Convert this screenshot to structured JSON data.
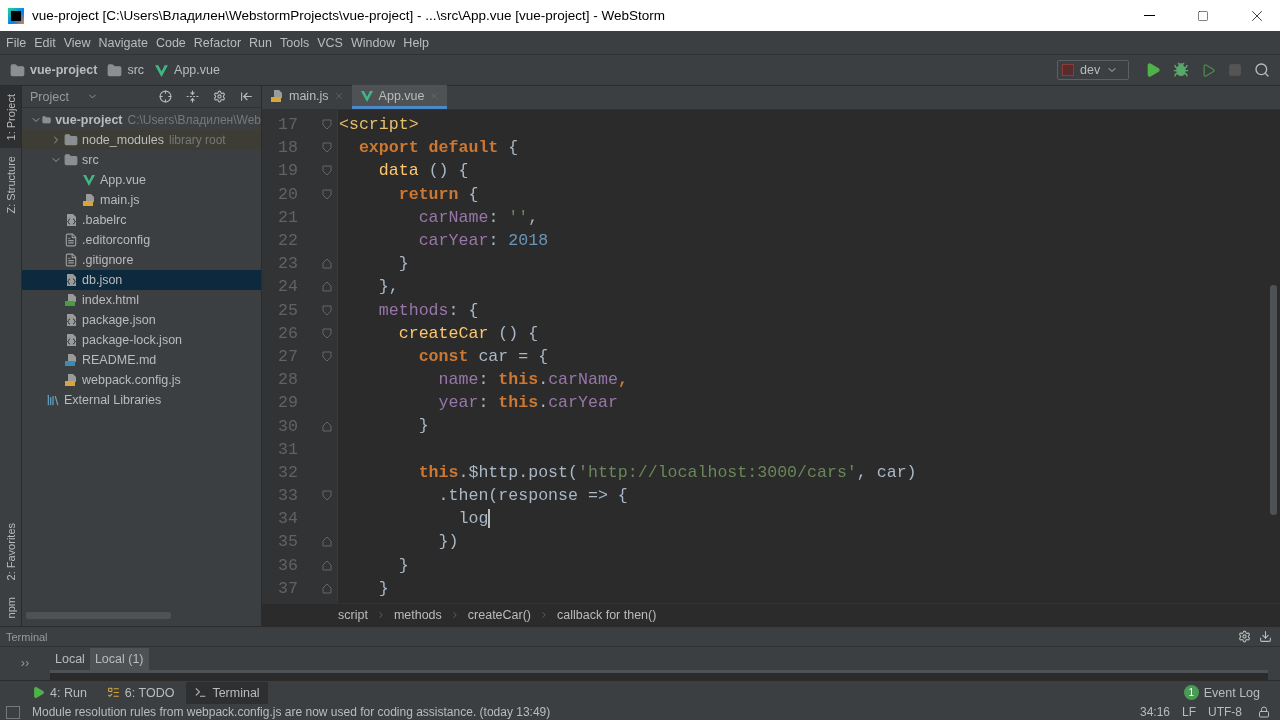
{
  "window": {
    "title": "vue-project [C:\\Users\\Владилен\\WebstormProjects\\vue-project] - ...\\src\\App.vue [vue-project] - WebStorm"
  },
  "menu": [
    "File",
    "Edit",
    "View",
    "Navigate",
    "Code",
    "Refactor",
    "Run",
    "Tools",
    "VCS",
    "Window",
    "Help"
  ],
  "nav_path": [
    {
      "label": "vue-project",
      "kind": "folder"
    },
    {
      "label": "src",
      "kind": "folder"
    },
    {
      "label": "App.vue",
      "kind": "vue"
    }
  ],
  "run_config": "dev",
  "left_strip": [
    "1: Project",
    "Z: Structure"
  ],
  "left_strip_bottom": [
    "2: Favorites",
    "npm"
  ],
  "project_panel": {
    "title": "Project",
    "tree": [
      {
        "label": "vue-project",
        "hint": "C:\\Users\\Владилен\\Web",
        "kind": "folder",
        "expanded": true,
        "selected": false,
        "children": [
          {
            "label": "node_modules",
            "hint": "library root",
            "kind": "folder",
            "expanded": false,
            "selected": false
          },
          {
            "label": "src",
            "kind": "folder",
            "expanded": true,
            "selected": false,
            "children": [
              {
                "label": "App.vue",
                "kind": "vue",
                "selected": false
              },
              {
                "label": "main.js",
                "kind": "js",
                "selected": false
              }
            ]
          },
          {
            "label": ".babelrc",
            "kind": "json",
            "selected": false
          },
          {
            "label": ".editorconfig",
            "kind": "text",
            "selected": false
          },
          {
            "label": ".gitignore",
            "kind": "text",
            "selected": false
          },
          {
            "label": "db.json",
            "kind": "json",
            "selected": true
          },
          {
            "label": "index.html",
            "kind": "html",
            "selected": false
          },
          {
            "label": "package.json",
            "kind": "json",
            "selected": false
          },
          {
            "label": "package-lock.json",
            "kind": "json",
            "selected": false
          },
          {
            "label": "README.md",
            "kind": "md",
            "selected": false
          },
          {
            "label": "webpack.config.js",
            "kind": "js",
            "selected": false
          }
        ]
      },
      {
        "label": "External Libraries",
        "kind": "libs",
        "selected": false
      }
    ]
  },
  "editor_tabs": [
    {
      "label": "main.js",
      "kind": "js",
      "selected": false
    },
    {
      "label": "App.vue",
      "kind": "vue",
      "selected": true
    }
  ],
  "code": [
    {
      "number": "17",
      "fold_start": true,
      "tokens": [
        {
          "kind": "tag",
          "text": "<script>"
        }
      ]
    },
    {
      "number": "18",
      "fold_start": true,
      "tokens": [
        {
          "kind": "kw",
          "text": "  export default"
        },
        {
          "kind": "plain",
          "text": " {"
        }
      ]
    },
    {
      "number": "19",
      "fold_start": true,
      "tokens": [
        {
          "kind": "fn",
          "text": "    data"
        },
        {
          "kind": "plain",
          "text": " () {"
        }
      ]
    },
    {
      "number": "20",
      "fold_start": true,
      "tokens": [
        {
          "kind": "kw",
          "text": "      return"
        },
        {
          "kind": "plain",
          "text": " {"
        }
      ]
    },
    {
      "number": "21",
      "tokens": [
        {
          "kind": "prop",
          "text": "        carName"
        },
        {
          "kind": "plain",
          "text": ": "
        },
        {
          "kind": "str",
          "text": "''"
        },
        {
          "kind": "plain",
          "text": ","
        }
      ]
    },
    {
      "number": "22",
      "tokens": [
        {
          "kind": "prop",
          "text": "        carYear"
        },
        {
          "kind": "plain",
          "text": ": "
        },
        {
          "kind": "num",
          "text": "2018"
        }
      ]
    },
    {
      "number": "23",
      "fold_end": true,
      "tokens": [
        {
          "kind": "plain",
          "text": "      }"
        }
      ]
    },
    {
      "number": "24",
      "fold_end": true,
      "tokens": [
        {
          "kind": "plain",
          "text": "    },"
        }
      ]
    },
    {
      "number": "25",
      "fold_start": true,
      "tokens": [
        {
          "kind": "prop",
          "text": "    methods"
        },
        {
          "kind": "plain",
          "text": ": {"
        }
      ]
    },
    {
      "number": "26",
      "fold_start": true,
      "tokens": [
        {
          "kind": "fn",
          "text": "      createCar"
        },
        {
          "kind": "plain",
          "text": " () {"
        }
      ]
    },
    {
      "number": "27",
      "fold_start": true,
      "tokens": [
        {
          "kind": "kw",
          "text": "        const"
        },
        {
          "kind": "plain",
          "text": " car = {"
        }
      ]
    },
    {
      "number": "28",
      "tokens": [
        {
          "kind": "prop",
          "text": "          name"
        },
        {
          "kind": "plain",
          "text": ": "
        },
        {
          "kind": "kw",
          "text": "this"
        },
        {
          "kind": "plain",
          "text": "."
        },
        {
          "kind": "prop",
          "text": "carName"
        },
        {
          "kind": "kw",
          "text": ","
        }
      ]
    },
    {
      "number": "29",
      "tokens": [
        {
          "kind": "prop",
          "text": "          year"
        },
        {
          "kind": "plain",
          "text": ": "
        },
        {
          "kind": "kw",
          "text": "this"
        },
        {
          "kind": "plain",
          "text": "."
        },
        {
          "kind": "prop",
          "text": "carYear"
        }
      ]
    },
    {
      "number": "30",
      "fold_end": true,
      "tokens": [
        {
          "kind": "plain",
          "text": "        }"
        }
      ]
    },
    {
      "number": "31"
    },
    {
      "number": "32",
      "tokens": [
        {
          "kind": "kw",
          "text": "        this"
        },
        {
          "kind": "plain",
          "text": ".$http.post("
        },
        {
          "kind": "str",
          "text": "'http://localhost:3000/cars'"
        },
        {
          "kind": "plain",
          "text": ", car)"
        }
      ]
    },
    {
      "number": "33",
      "fold_start": true,
      "tokens": [
        {
          "kind": "plain",
          "text": "          .then(response => {"
        }
      ]
    },
    {
      "number": "34",
      "current": true,
      "tokens": [
        {
          "kind": "plain",
          "text": "            log"
        }
      ]
    },
    {
      "number": "35",
      "fold_end": true,
      "tokens": [
        {
          "kind": "plain",
          "text": "          })"
        }
      ]
    },
    {
      "number": "36",
      "fold_end": true,
      "tokens": [
        {
          "kind": "plain",
          "text": "      }"
        }
      ]
    },
    {
      "number": "37",
      "fold_end": true,
      "tokens": [
        {
          "kind": "plain",
          "text": "    }"
        }
      ]
    }
  ],
  "breadcrumbs": [
    "script",
    "methods",
    "createCar()",
    "callback for then()"
  ],
  "terminal": {
    "title": "Terminal",
    "tabs": [
      {
        "label": "Local",
        "selected": false
      },
      {
        "label": "Local (1)",
        "selected": true
      }
    ],
    "expand": "››"
  },
  "tool_windows": [
    {
      "kind": "run",
      "label": "4: Run",
      "selected": false
    },
    {
      "kind": "todo",
      "label": "6: TODO",
      "selected": false
    },
    {
      "kind": "terminal",
      "label": "Terminal",
      "selected": true
    }
  ],
  "event_log": {
    "count": "1",
    "label": "Event Log"
  },
  "status": {
    "message": "Module resolution rules from webpack.config.js are now used for coding assistance. (today 13:49)",
    "position": "34:16",
    "line_sep": "LF",
    "encoding": "UTF-8"
  }
}
